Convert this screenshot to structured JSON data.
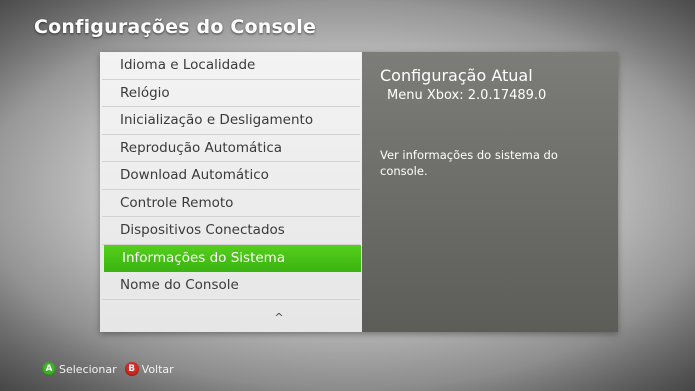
{
  "header": {
    "title": "Configurações do Console"
  },
  "menu": {
    "items": [
      "Idioma e Localidade",
      "Relógio",
      "Inicialização e Desligamento",
      "Reprodução Automática",
      "Download Automático",
      "Controle Remoto",
      "Dispositivos Conectados",
      "Informações do Sistema",
      "Nome do Console"
    ],
    "selected_index": 7,
    "scroll_indicator": "^"
  },
  "info": {
    "title": "Configuração Atual",
    "subtitle": "Menu Xbox: 2.0.17489.0",
    "description": "Ver informações do sistema do console."
  },
  "footer": {
    "buttons": [
      {
        "glyph": "A",
        "label": "Selecionar",
        "color": "#3fb12a"
      },
      {
        "glyph": "B",
        "label": "Voltar",
        "color": "#d62a25"
      }
    ]
  },
  "colors": {
    "accent_green": "#44c016",
    "button_a": "#3fb12a",
    "button_b": "#d62a25"
  }
}
